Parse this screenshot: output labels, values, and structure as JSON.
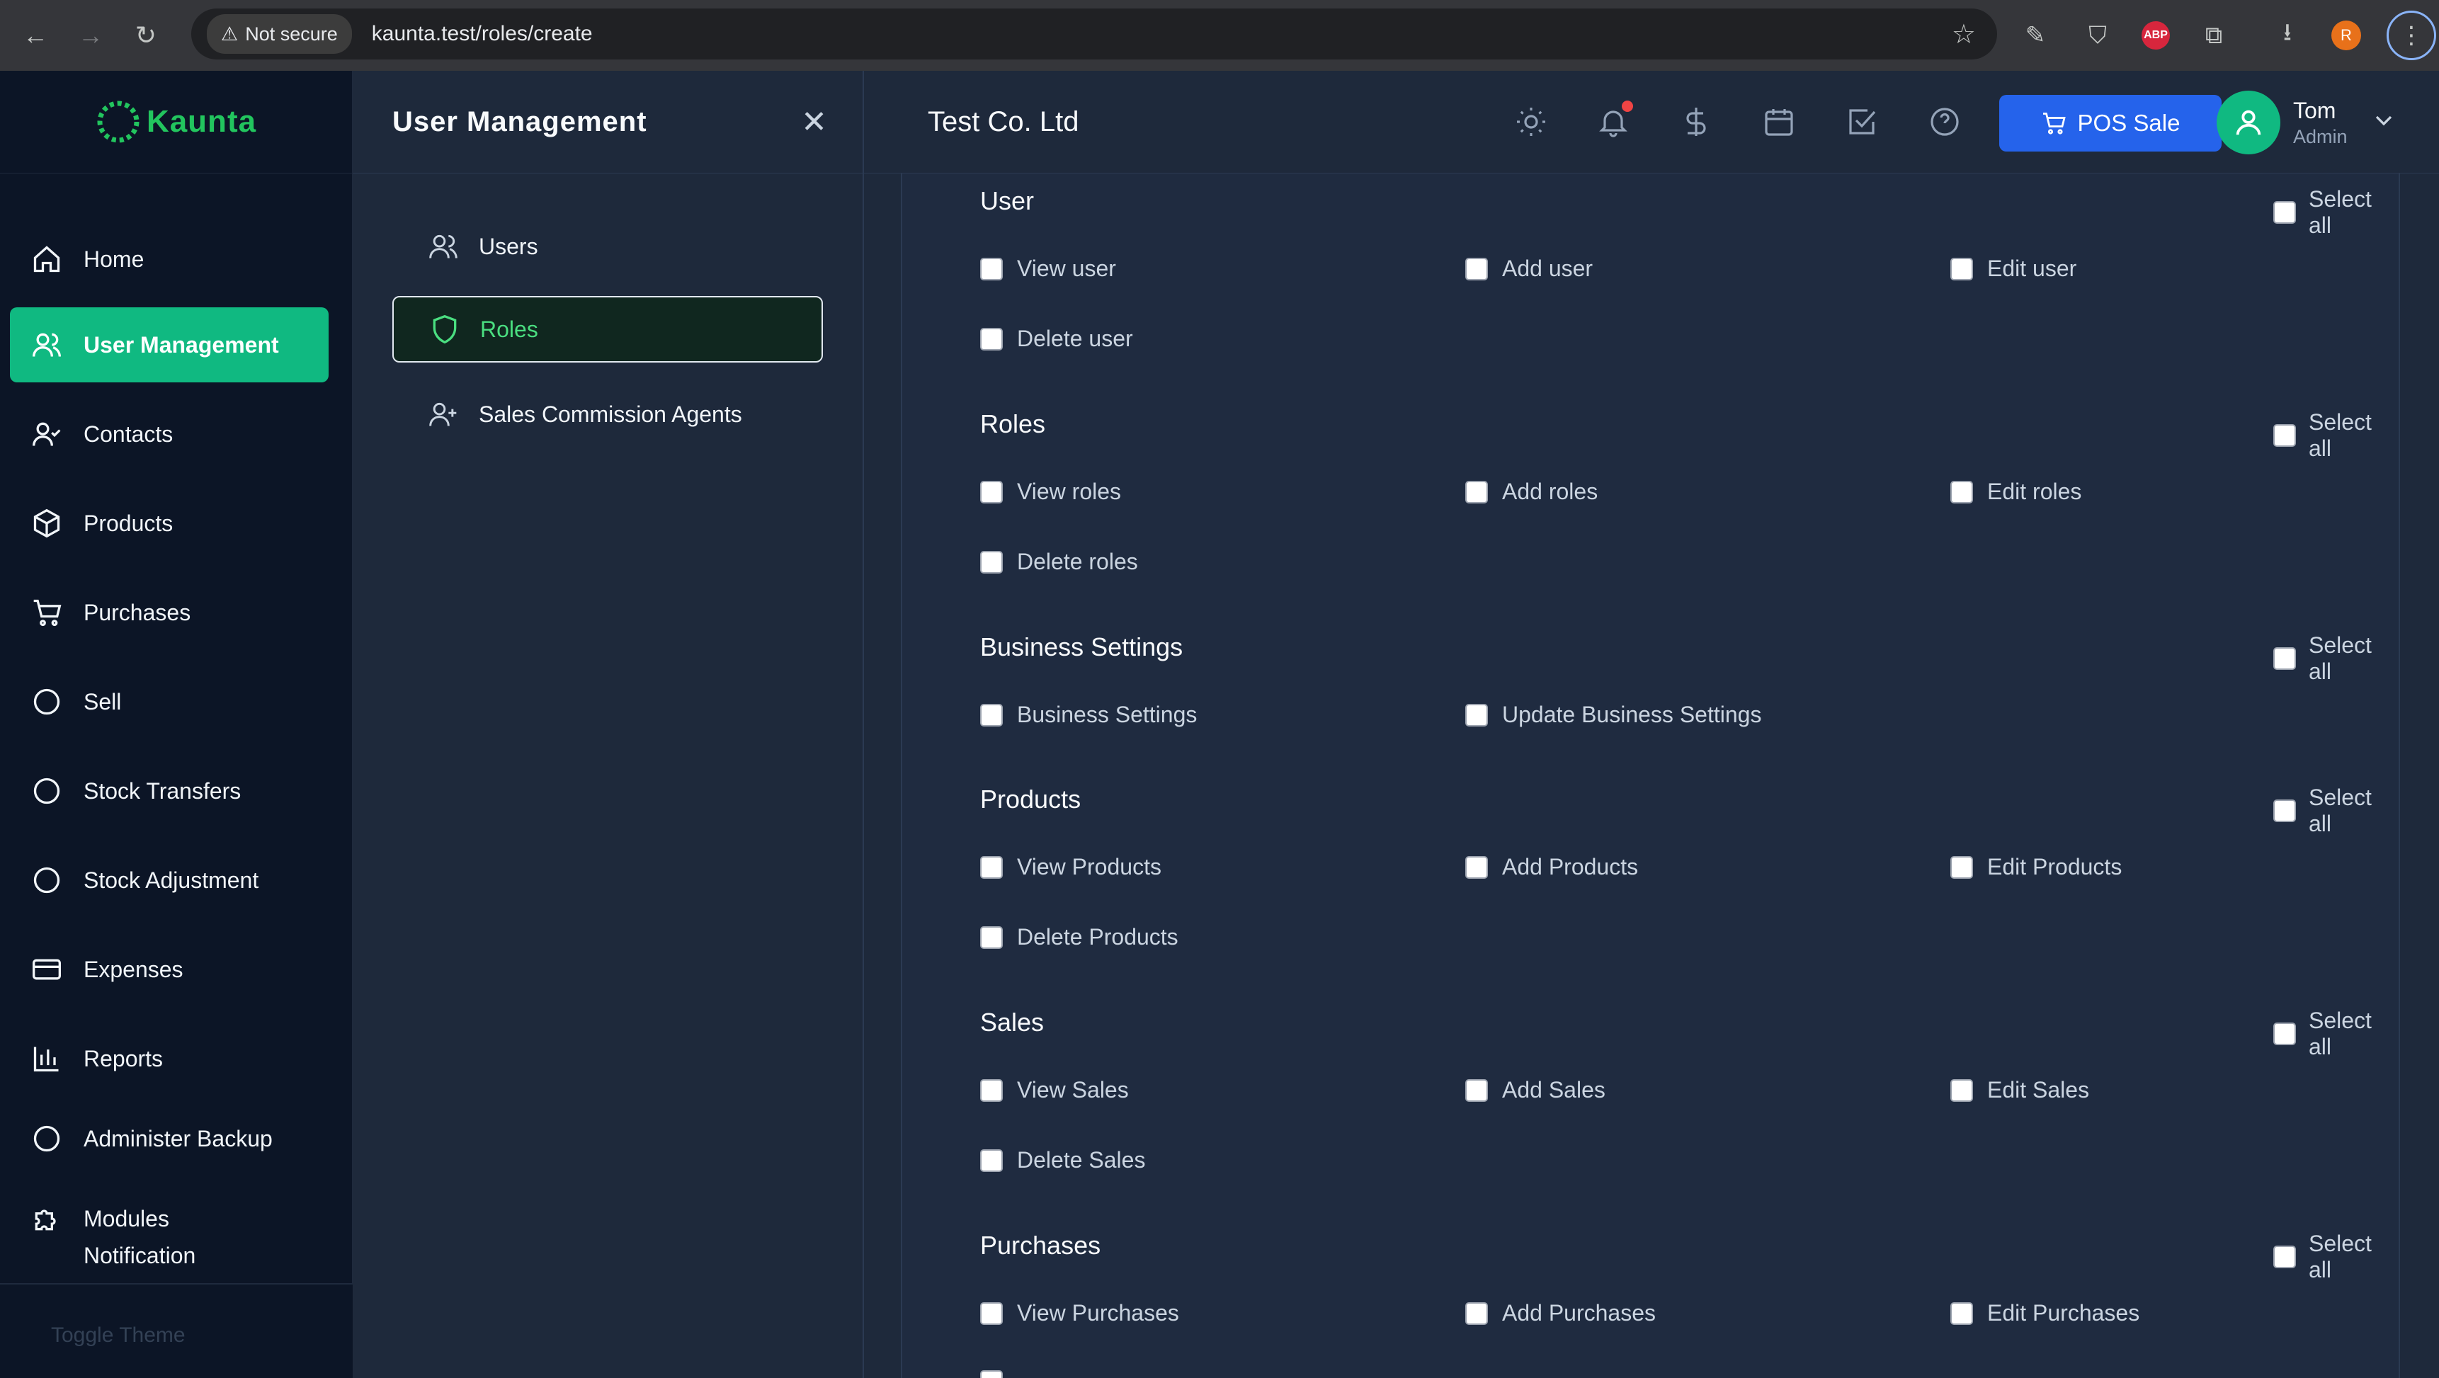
{
  "browser": {
    "security_label": "Not secure",
    "url": "kaunta.test/roles/create",
    "profile_initial": "R",
    "abp_label": "ABP"
  },
  "brand": {
    "name": "Kaunta",
    "color": "#22c55e"
  },
  "sidebar": {
    "items": [
      {
        "label": "Home",
        "icon": "home-icon"
      },
      {
        "label": "User Management",
        "icon": "users-icon",
        "active": true
      },
      {
        "label": "Contacts",
        "icon": "user-check-icon"
      },
      {
        "label": "Products",
        "icon": "box-icon"
      },
      {
        "label": "Purchases",
        "icon": "cart-icon"
      },
      {
        "label": "Sell",
        "icon": "circle-icon"
      },
      {
        "label": "Stock Transfers",
        "icon": "circle-icon"
      },
      {
        "label": "Stock Adjustment",
        "icon": "circle-icon"
      },
      {
        "label": "Expenses",
        "icon": "credit-card-icon"
      },
      {
        "label": "Reports",
        "icon": "bar-chart-icon"
      },
      {
        "label": "Administer Backup",
        "icon": "circle-icon"
      },
      {
        "label": "Modules",
        "icon": "puzzle-icon"
      },
      {
        "label": "Notification",
        "icon": "none"
      }
    ],
    "footer": "Toggle Theme"
  },
  "submenu": {
    "title": "User Management",
    "items": [
      {
        "label": "Users",
        "icon": "users-icon"
      },
      {
        "label": "Roles",
        "icon": "shield-icon",
        "active": true
      },
      {
        "label": "Sales Commission Agents",
        "icon": "user-plus-icon"
      }
    ]
  },
  "header": {
    "company": "Test Co. Ltd",
    "pos_button": "POS Sale",
    "user_name": "Tom",
    "user_role": "Admin",
    "accent": "#2563eb"
  },
  "permissions": {
    "select_all_label": "Select all",
    "sections": [
      {
        "title": "User",
        "items": [
          "View user",
          "Add user",
          "Edit user",
          "Delete user"
        ]
      },
      {
        "title": "Roles",
        "items": [
          "View roles",
          "Add roles",
          "Edit roles",
          "Delete roles"
        ]
      },
      {
        "title": "Business Settings",
        "items": [
          "Business Settings",
          "Update Business Settings"
        ]
      },
      {
        "title": "Products",
        "items": [
          "View Products",
          "Add Products",
          "Edit Products",
          "Delete Products"
        ]
      },
      {
        "title": "Sales",
        "items": [
          "View Sales",
          "Add Sales",
          "Edit Sales",
          "Delete Sales"
        ]
      },
      {
        "title": "Purchases",
        "items": [
          "View Purchases",
          "Add Purchases",
          "Edit Purchases"
        ]
      }
    ]
  }
}
